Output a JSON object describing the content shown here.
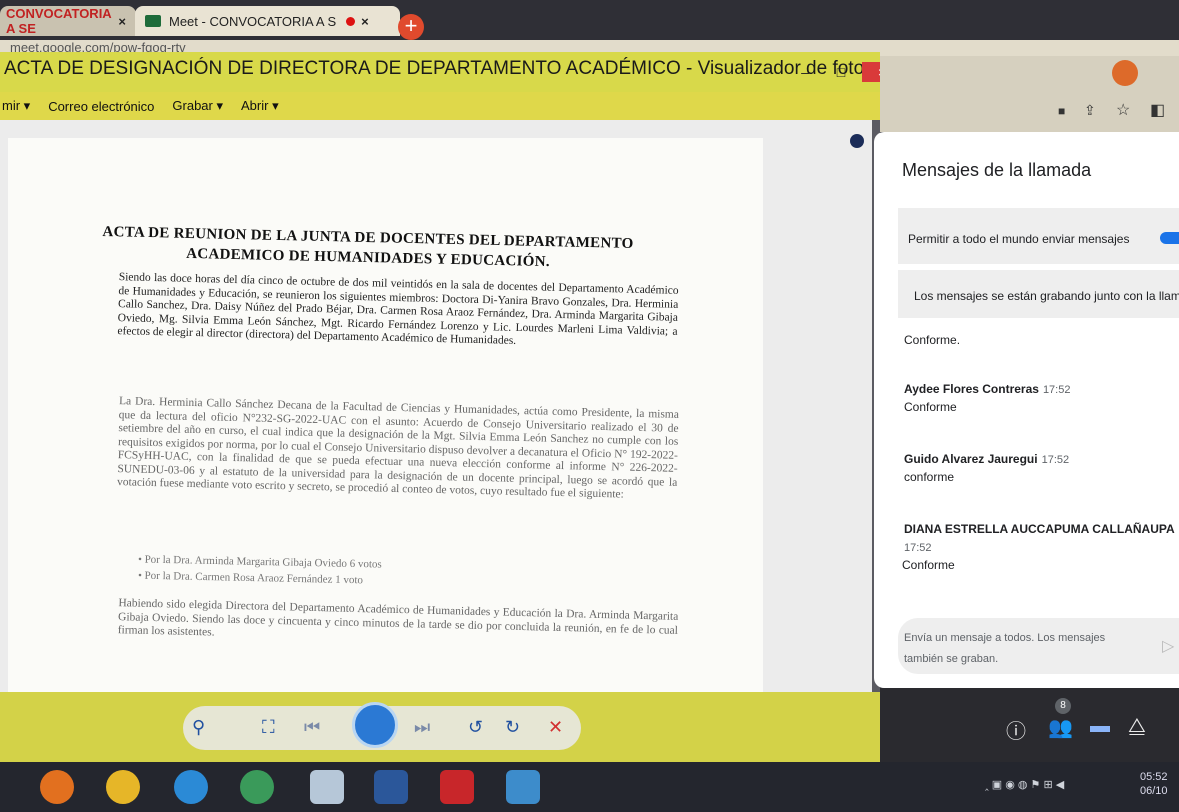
{
  "browser": {
    "tab1_label": "CONVOCATORIA A SE",
    "tab2_label": "Meet - CONVOCATORIA A S",
    "tab_close": "×",
    "new_tab": "+",
    "address": "meet.google.com/pow-fqog-rtv"
  },
  "viewer": {
    "title": "ACTA DE DESIGNACIÓN DE DIRECTORA DE DEPARTAMENTO ACADÉMICO - Visualizador de fotos de Windows",
    "btn_min": "–",
    "btn_max": "□",
    "btn_close": "×",
    "menu": [
      "mir",
      "Correo electrónico",
      "Grabar",
      "Abrir"
    ]
  },
  "document": {
    "title_line1": "ACTA DE REUNION DE LA JUNTA DE DOCENTES DEL DEPARTAMENTO",
    "title_line2": "ACADEMICO DE HUMANIDADES Y EDUCACIÓN.",
    "para1": "Siendo las doce horas del día cinco de octubre de dos mil veintidós en la sala de docentes del Departamento Académico de Humanidades y Educación, se reunieron los siguientes miembros: Doctora Di-Yanira Bravo Gonzales, Dra. Herminia Callo Sanchez, Dra. Daisy Núñez del Prado Béjar, Dra. Carmen Rosa Araoz Fernández, Dra. Arminda Margarita Gibaja Oviedo, Mg. Silvia Emma León Sánchez, Mgt. Ricardo Fernández Lorenzo y Lic. Lourdes Marleni Lima Valdivia; a efectos de elegir al director (directora) del Departamento Académico de Humanidades.",
    "para2": "La Dra. Herminia Callo Sánchez Decana de la Facultad de Ciencias y Humanidades, actúa como Presidente, la misma que da lectura del oficio N°232-SG-2022-UAC con el asunto: Acuerdo de Consejo Universitario realizado el 30 de setiembre del año en curso, el cual indica que la designación de la Mgt. Silvia Emma León Sanchez no cumple con los requisitos exigidos por norma, por lo cual el Consejo Universitario dispuso devolver a decanatura el Oficio N° 192-2022-FCSyHH-UAC, con la finalidad de que se pueda efectuar una nueva elección conforme al informe N° 226-2022-SUNEDU-03-06 y al estatuto de la universidad para la designación de un docente principal, luego se acordó que la votación fuese mediante voto escrito y secreto, se procedió al conteo de votos, cuyo resultado fue el siguiente:",
    "bullet1": "•   Por la Dra. Arminda Margarita Gibaja Oviedo 6 votos",
    "bullet2": "•   Por la Dra. Carmen Rosa Araoz Fernández 1 voto",
    "para3": "Habiendo sido elegida Directora del Departamento Académico de Humanidades y Educación la Dra. Arminda Margarita Gibaja Oviedo. Siendo las doce y cincuenta y cinco minutos de la tarde se dio por concluida la reunión, en fe de lo cual firman los asistentes."
  },
  "chat": {
    "title": "Mensajes de la llamada",
    "allow_label": "Permitir a todo el mundo enviar mensajes",
    "allow_enabled": true,
    "recording_notice": "Los mensajes se están grabando junto con la llamada",
    "messages": [
      {
        "sender": "",
        "time": "",
        "text": "Conforme."
      },
      {
        "sender": "Aydee Flores Contreras",
        "time": "17:52",
        "text": "Conforme"
      },
      {
        "sender": "Guido Alvarez Jauregui",
        "time": "17:52",
        "text": "conforme"
      },
      {
        "sender": "DIANA ESTRELLA AUCCAPUMA CALLAÑAUPA",
        "time": "17:52",
        "text": "Conforme"
      }
    ],
    "compose_placeholder": "Envía un mensaje a todos. Los mensajes también se graban.",
    "participants_badge": "8"
  },
  "taskbar": {
    "clock_time": "05:52",
    "clock_date": "06/10"
  }
}
